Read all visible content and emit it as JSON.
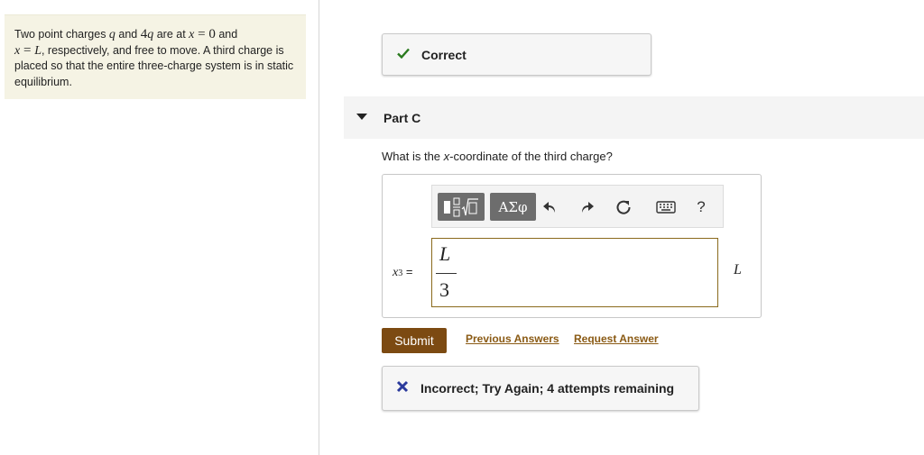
{
  "problem": {
    "p1": "Two point charges ",
    "q1": "q",
    "p2": " and ",
    "q2_coef": "4",
    "q2_var": "q",
    "p3": " are at ",
    "x_a": "x",
    "eq_a": " = ",
    "zero": "0",
    "p4": " and",
    "x_b": "x",
    "eq_b": " = ",
    "L": "L",
    "p5": ", respectively, and free to move. A third charge is placed so that the entire three-charge system is in static equilibrium."
  },
  "correct_feedback": {
    "text": "Correct",
    "icon": "check-icon"
  },
  "part": {
    "title": "Part C"
  },
  "question": {
    "before": "What is the ",
    "var": "x",
    "after": "-coordinate of the third charge?"
  },
  "toolbar": {
    "templates_icon": "fraction-sqrt-icon",
    "greek_label": "ΑΣφ",
    "undo_icon": "undo-icon",
    "redo_icon": "redo-icon",
    "reset_icon": "reset-icon",
    "keyboard_icon": "keyboard-icon",
    "help_label": "?"
  },
  "answer": {
    "var_label": "x",
    "var_sub": "3",
    "equals": " =",
    "numerator": "L",
    "denominator": "3",
    "unit": "L"
  },
  "actions": {
    "submit_label": "Submit",
    "previous_label": "Previous Answers",
    "request_label": "Request Answer"
  },
  "incorrect_feedback": {
    "text": "Incorrect; Try Again; 4 attempts remaining",
    "icon": "x-icon"
  },
  "colors": {
    "correct_icon": "#2a7a1e",
    "incorrect_icon": "#2b3a9c",
    "submit_bg": "#7c4a12",
    "link": "#8a5a14"
  }
}
